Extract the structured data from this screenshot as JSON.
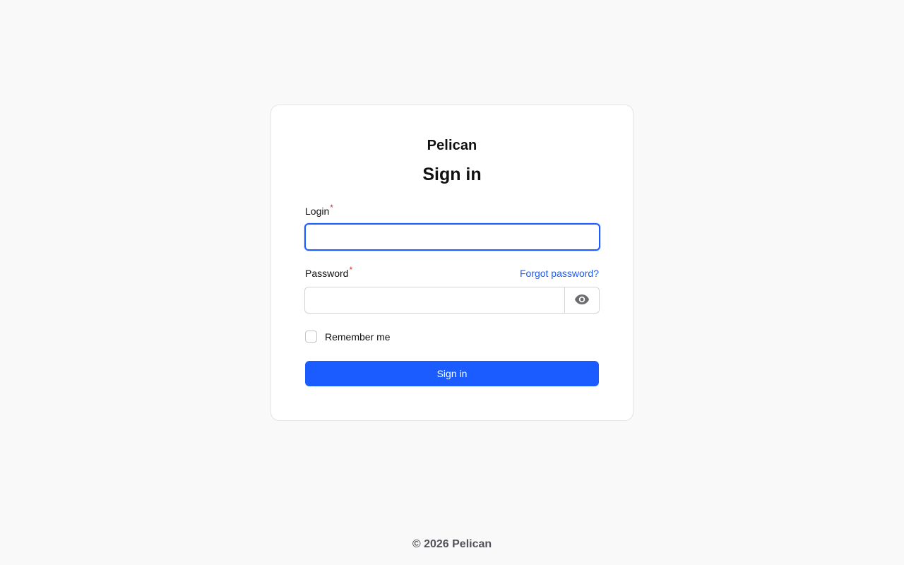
{
  "brand": "Pelican",
  "heading": "Sign in",
  "login": {
    "label": "Login",
    "required_marker": "*",
    "value": "",
    "placeholder": ""
  },
  "password": {
    "label": "Password",
    "required_marker": "*",
    "value": "",
    "placeholder": "",
    "reveal_icon": "eye-icon"
  },
  "forgot_password": "Forgot password?",
  "remember_me": {
    "label": "Remember me",
    "checked": false
  },
  "submit_label": "Sign in",
  "footer": "© 2026 Pelican",
  "colors": {
    "accent": "#1a5cff",
    "required": "#e5232f",
    "background": "#f9f9f9",
    "card": "#ffffff"
  }
}
